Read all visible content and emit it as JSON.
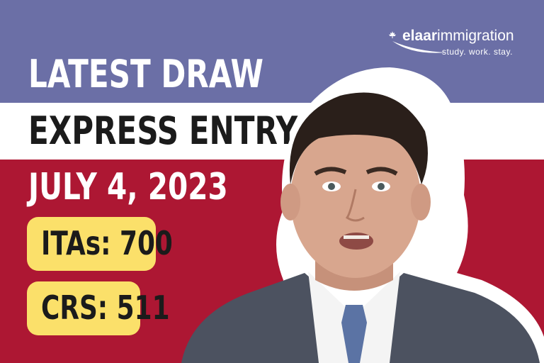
{
  "brand": {
    "name_bold": "elaar",
    "name_regular": "immigration",
    "tagline": "study. work. stay."
  },
  "headline": {
    "line1": "LATEST DRAW",
    "line2": "EXPRESS ENTRY",
    "date": "JULY 4, 2023"
  },
  "stats": {
    "itas": "ITAs: 700",
    "crs": "CRS: 511"
  },
  "colors": {
    "top_band": "#6b6fa6",
    "middle_band": "#ffffff",
    "bottom_band": "#ad1733",
    "pill": "#fbe06a"
  },
  "icons": {
    "brand_mark": "maple-leaf-icon"
  }
}
